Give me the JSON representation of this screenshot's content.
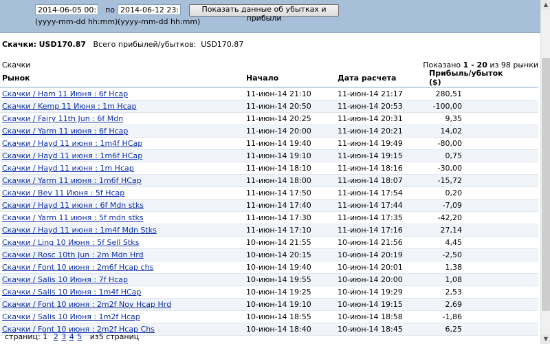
{
  "filter": {
    "from_value": "2014-06-05 00:00",
    "to_label": "по",
    "to_value": "2014-06-12 23:59",
    "show_button": "Показать данные об убытках и прибыли",
    "from_format_hint": "(yyyy-mm-dd hh:mm)",
    "to_format_hint": "(yyyy-mm-dd hh:mm)"
  },
  "summary": {
    "label": "Скачки:",
    "amount": "USD170.87",
    "total_label": "Всего прибылей/убытков:",
    "total_amount": "USD170.87"
  },
  "section_title": "Скачки",
  "shown": {
    "prefix": "Показано",
    "range": "1 - 20",
    "suffix": "из 98 рынки"
  },
  "table": {
    "headers": {
      "market": "Рынок",
      "start": "Начало",
      "settled": "Дата расчета",
      "pl": "Прибыль/убыток ($)"
    },
    "rows": [
      {
        "market": "Скачки / Ham 11 Июня : 6f Hcap",
        "start": "11-июн-14 21:10",
        "settled": "11-июн-14 21:17",
        "pl": "280,51"
      },
      {
        "market": "Скачки / Kemp 11 Июня : 1m Hcap",
        "start": "11-июн-14 20:50",
        "settled": "11-июн-14 20:53",
        "pl": "-100,00"
      },
      {
        "market": "Скачки / Fairy 11th Jun : 6f Mdn",
        "start": "11-июн-14 20:25",
        "settled": "11-июн-14 20:31",
        "pl": "9,35"
      },
      {
        "market": "Скачки / Yarm 11 июня : 6f Hcap",
        "start": "11-июн-14 20:00",
        "settled": "11-июн-14 20:21",
        "pl": "14,02"
      },
      {
        "market": "Скачки / Hayd 11 июня : 1m4f HCap",
        "start": "11-июн-14 19:40",
        "settled": "11-июн-14 19:49",
        "pl": "-80,00"
      },
      {
        "market": "Скачки / Hayd 11 июня : 1m6f HCap",
        "start": "11-июн-14 19:10",
        "settled": "11-июн-14 19:15",
        "pl": "0,75"
      },
      {
        "market": "Скачки / Hayd 11 июня : 1m Hcap",
        "start": "11-июн-14 18:10",
        "settled": "11-июн-14 18:16",
        "pl": "-30,00"
      },
      {
        "market": "Скачки / Yarm 11 июня : 1m6f HCap",
        "start": "11-июн-14 18:00",
        "settled": "11-июн-14 18:07",
        "pl": "-15,72"
      },
      {
        "market": "Скачки / Bev 11 Июня : 5f Hcap",
        "start": "11-июн-14 17:50",
        "settled": "11-июн-14 17:54",
        "pl": "0,20"
      },
      {
        "market": "Скачки / Hayd 11 июня : 6f Mdn stks",
        "start": "11-июн-14 17:40",
        "settled": "11-июн-14 17:44",
        "pl": "-7,09"
      },
      {
        "market": "Скачки / Yarm 11 июня : 5f mdn stks",
        "start": "11-июн-14 17:30",
        "settled": "11-июн-14 17:35",
        "pl": "-42,20"
      },
      {
        "market": "Скачки / Hayd 11 июня : 1m4f Mdn Stks",
        "start": "11-июн-14 17:10",
        "settled": "11-июн-14 17:16",
        "pl": "27,14"
      },
      {
        "market": "Скачки / Ling 10 Июня : 5f Sell Stks",
        "start": "10-июн-14 21:55",
        "settled": "10-июн-14 21:56",
        "pl": "4,45"
      },
      {
        "market": "Скачки / Rosc 10th Jun : 2m Mdn Hrd",
        "start": "10-июн-14 20:15",
        "settled": "10-июн-14 20:19",
        "pl": "-2,50"
      },
      {
        "market": "Скачки / Font 10 июня : 2m6f Hcap chs",
        "start": "10-июн-14 19:40",
        "settled": "10-июн-14 20:01",
        "pl": "1,38"
      },
      {
        "market": "Скачки / Salis 10 Июня : 7f Hcap",
        "start": "10-июн-14 19:55",
        "settled": "10-июн-14 20:00",
        "pl": "1,08"
      },
      {
        "market": "Скачки / Salis 10 Июня : 1m4f HCap",
        "start": "10-июн-14 19:25",
        "settled": "10-июн-14 19:29",
        "pl": "2,53"
      },
      {
        "market": "Скачки / Font 10 июня : 2m2f Nov Hcap Hrd",
        "start": "10-июн-14 19:10",
        "settled": "10-июн-14 19:15",
        "pl": "2,69"
      },
      {
        "market": "Скачки / Salis 10 Июня : 1m2f Hcap",
        "start": "10-июн-14 18:55",
        "settled": "10-июн-14 18:58",
        "pl": "-1,86"
      },
      {
        "market": "Скачки / Font 10 июня : 2m2f Hcap Chs",
        "start": "10-июн-14 18:40",
        "settled": "10-июн-14 18:45",
        "pl": "6,25"
      }
    ]
  },
  "pager": {
    "label": "страниц:",
    "current": "1",
    "pages": [
      "2",
      "3",
      "4",
      "5"
    ],
    "total": "из5 страниц"
  },
  "icons": {
    "scroll_up": "scroll-up-arrow-icon",
    "scroll_down": "scroll-down-arrow-icon"
  }
}
